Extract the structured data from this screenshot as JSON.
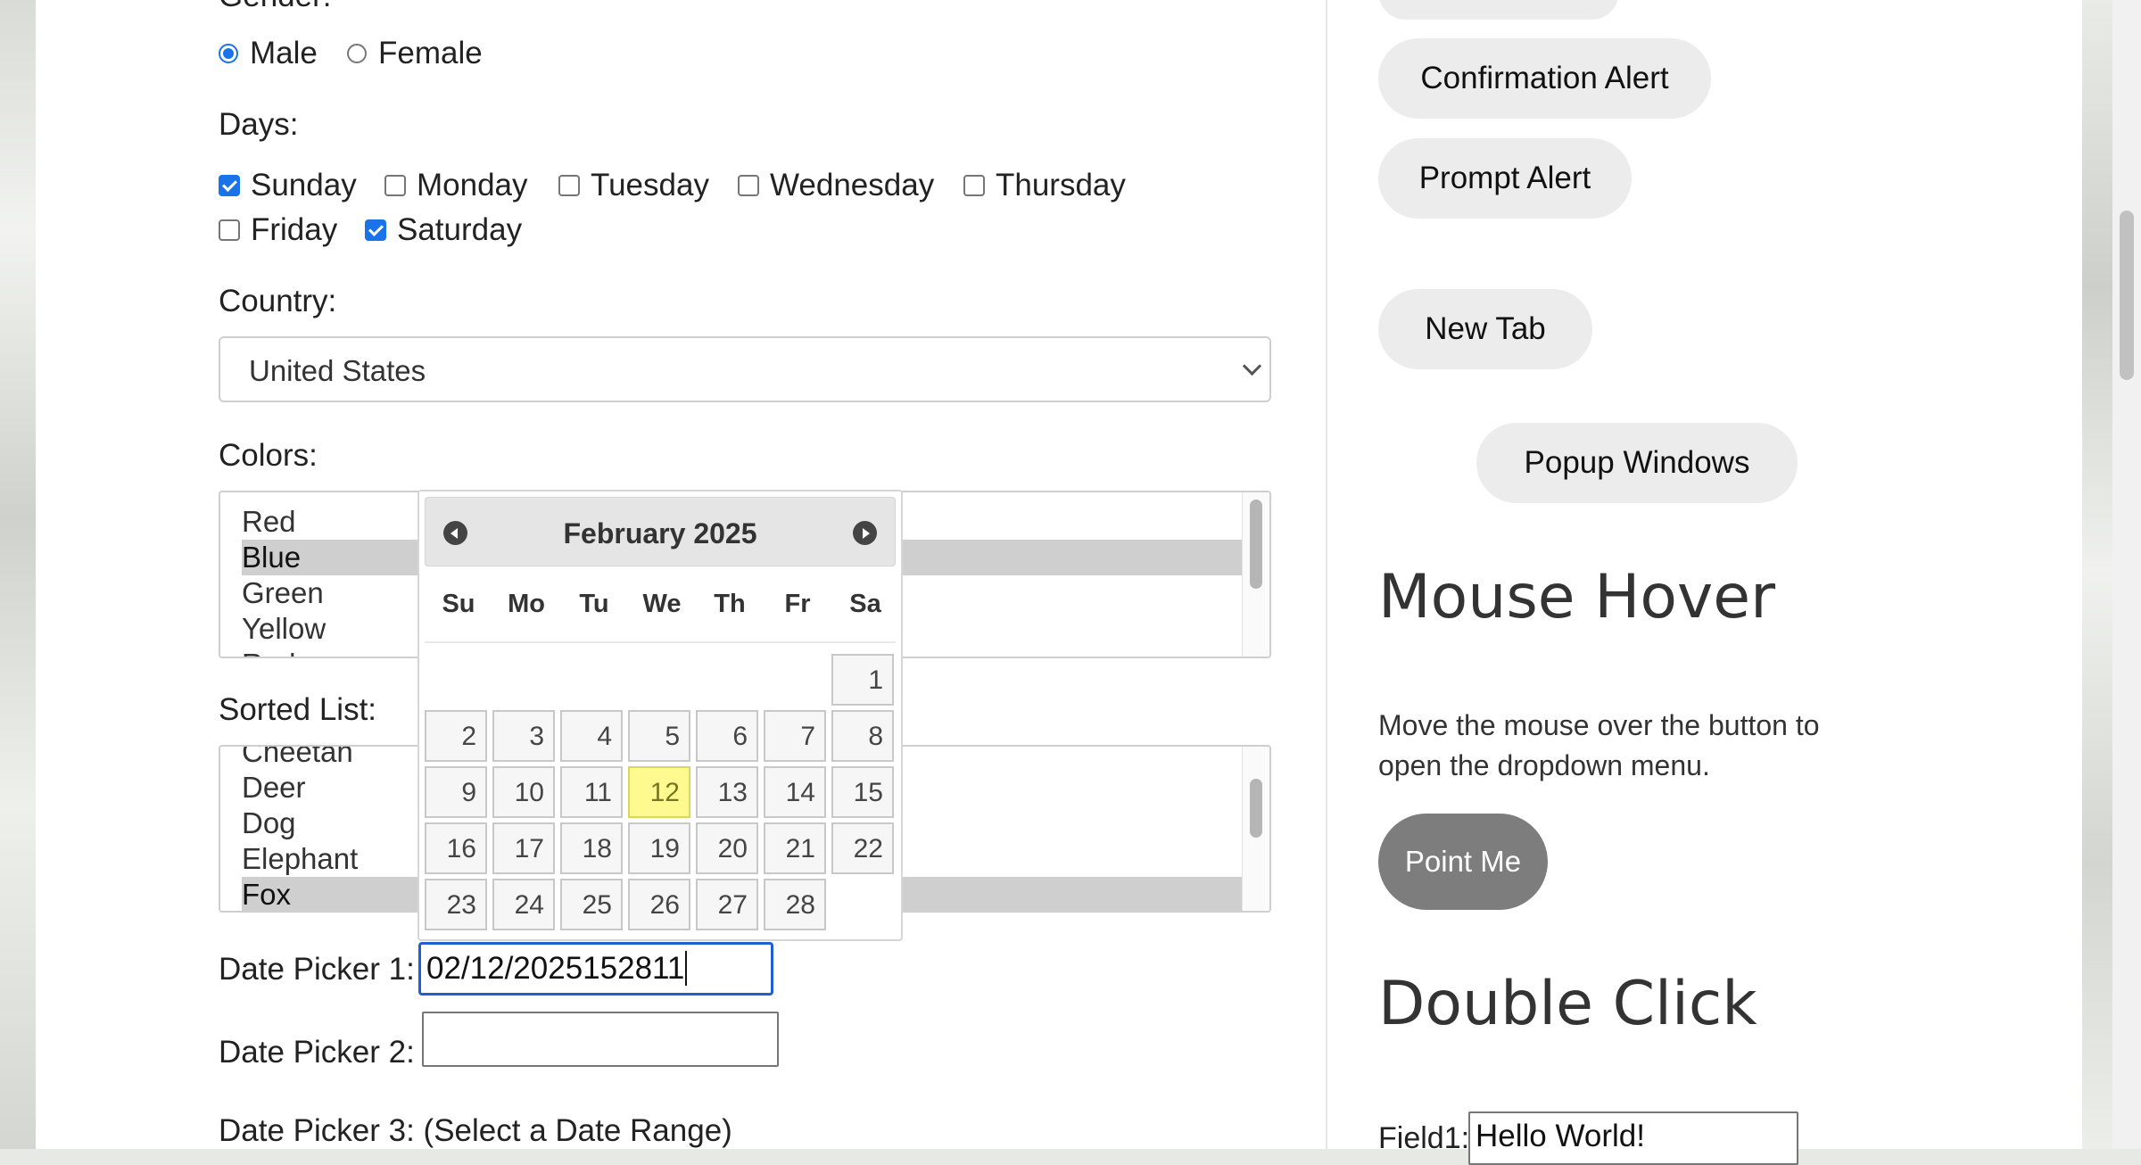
{
  "gender": {
    "label": "Gender:",
    "options": [
      {
        "label": "Male",
        "checked": true
      },
      {
        "label": "Female",
        "checked": false
      }
    ]
  },
  "days": {
    "label": "Days:",
    "options": [
      {
        "label": "Sunday",
        "checked": true
      },
      {
        "label": "Monday",
        "checked": false
      },
      {
        "label": "Tuesday",
        "checked": false
      },
      {
        "label": "Wednesday",
        "checked": false
      },
      {
        "label": "Thursday",
        "checked": false
      },
      {
        "label": "Friday",
        "checked": false
      },
      {
        "label": "Saturday",
        "checked": true
      }
    ]
  },
  "country": {
    "label": "Country:",
    "selected": "United States"
  },
  "colors": {
    "label": "Colors:",
    "items": [
      "Red",
      "Blue",
      "Green",
      "Yellow",
      "Red"
    ],
    "selected": "Blue"
  },
  "sorted_list": {
    "label": "Sorted List:",
    "items": [
      "Cheetah",
      "Deer",
      "Dog",
      "Elephant",
      "Fox"
    ],
    "selected": "Fox"
  },
  "date_picker_1": {
    "label": "Date Picker 1:",
    "value": "02/12/2025152811"
  },
  "date_picker_2": {
    "label": "Date Picker 2:",
    "value": ""
  },
  "date_picker_3": {
    "label": "Date Picker 3: (Select a Date Range)"
  },
  "calendar": {
    "title": "February 2025",
    "weekdays": [
      "Su",
      "Mo",
      "Tu",
      "We",
      "Th",
      "Fr",
      "Sa"
    ],
    "first_weekday_index": 6,
    "days_in_month": 28,
    "highlighted_day": 12
  },
  "alerts": {
    "confirmation": "Confirmation Alert",
    "prompt": "Prompt Alert"
  },
  "new_tab": "New Tab",
  "popup_windows": "Popup Windows",
  "mouse_hover": {
    "heading": "Mouse Hover",
    "description": "Move the mouse over the button to open the dropdown menu.",
    "button": "Point Me"
  },
  "double_click": {
    "heading": "Double Click",
    "field1_label": "Field1:",
    "field1_value": "Hello World!"
  }
}
